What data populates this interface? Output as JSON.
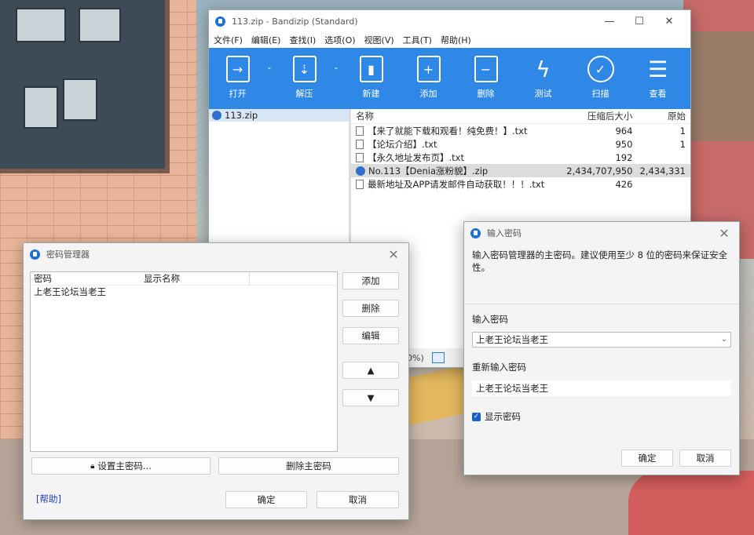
{
  "bandizip": {
    "title": "113.zip - Bandizip (Standard)",
    "menu": [
      "文件(F)",
      "编辑(E)",
      "查找(I)",
      "选项(O)",
      "视图(V)",
      "工具(T)",
      "帮助(H)"
    ],
    "toolbar": [
      "打开",
      "解压",
      "新建",
      "添加",
      "删除",
      "测试",
      "扫描",
      "查看"
    ],
    "tree_item": "113.zip",
    "columns": {
      "name": "名称",
      "size": "压缩后大小",
      "orig": "原始"
    },
    "files": [
      {
        "name": "【来了就能下载和观看！纯免费！】.txt",
        "size": "964",
        "orig": "1"
      },
      {
        "name": "【论坛介绍】.txt",
        "size": "950",
        "orig": "1"
      },
      {
        "name": "【永久地址发布页】.txt",
        "size": "192",
        "orig": ""
      },
      {
        "name": "No.113【Denia涨粉貌】.zip",
        "size": "2,434,707,950",
        "orig": "2,434,331"
      },
      {
        "name": "最新地址及APP请发邮件自动获取！！！.txt",
        "size": "426",
        "orig": ""
      }
    ],
    "status_text": "0%)"
  },
  "pwdmgr": {
    "title": "密码管理器",
    "col_password": "密码",
    "col_display": "显示名称",
    "entries": [
      {
        "password": "上老王论坛当老王",
        "display": ""
      }
    ],
    "add": "添加",
    "delete": "删除",
    "edit": "编辑",
    "up": "▲",
    "down": "▼",
    "set_master": "设置主密码...",
    "delete_master": "删除主密码",
    "help": "[帮助]",
    "ok": "确定",
    "cancel": "取消"
  },
  "enterpw": {
    "title": "输入密码",
    "desc": "输入密码管理器的主密码。建议使用至少 8 位的密码来保证安全性。",
    "label_pw": "输入密码",
    "pw_value": "上老王论坛当老王",
    "label_repeat": "重新输入密码",
    "repeat_value": "上老王论坛当老王",
    "show_pw": "显示密码",
    "ok": "确定",
    "cancel": "取消"
  },
  "colors": {
    "accent": "#2f87e6",
    "link": "#2340c8"
  }
}
